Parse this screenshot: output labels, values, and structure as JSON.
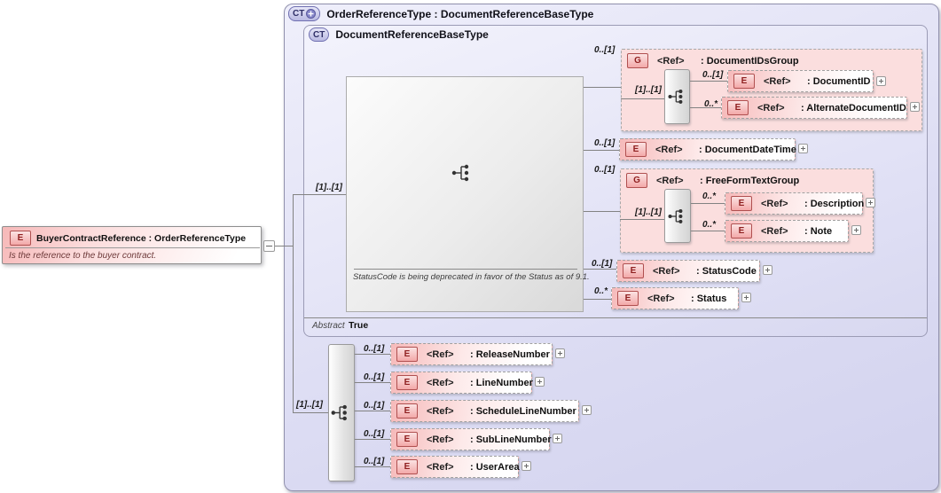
{
  "palette": {
    "container_fill": "#dcdcf3",
    "element_pink": "#f6baba",
    "badge_text_red": "#8f1f1f",
    "ct_badge_fill": "#c3c3e8",
    "connector_gray": "#828282"
  },
  "left_element": {
    "badge": "E",
    "title": "BuyerContractReference : OrderReferenceType",
    "annotation": "Is the reference to the buyer contract."
  },
  "outer_type": {
    "badge": "CT",
    "title": "OrderReferenceType : DocumentReferenceBaseType"
  },
  "base_type": {
    "badge": "CT",
    "title": "DocumentReferenceBaseType",
    "abstract_label": "Abstract",
    "abstract_value": "True",
    "model_note": "StatusCode is being deprecated in favor of the Status as of 9.1.",
    "model_card": "[1]..[1]"
  },
  "extension_card": "[1]..[1]",
  "top": [
    {
      "kind": "group",
      "card": "0..[1]",
      "badge": "G",
      "ref": "<Ref>",
      "name": ": DocumentIDsGroup",
      "inner_card": "[1]..[1]",
      "children": [
        {
          "card": "0..[1]",
          "badge": "E",
          "ref": "<Ref>",
          "name": ": DocumentID"
        },
        {
          "card": "0..*",
          "badge": "E",
          "ref": "<Ref>",
          "name": ": AlternateDocumentID"
        }
      ]
    },
    {
      "kind": "element",
      "card": "0..[1]",
      "badge": "E",
      "ref": "<Ref>",
      "name": ": DocumentDateTime"
    },
    {
      "kind": "group",
      "card": "0..[1]",
      "badge": "G",
      "ref": "<Ref>",
      "name": ": FreeFormTextGroup",
      "inner_card": "[1]..[1]",
      "children": [
        {
          "card": "0..*",
          "badge": "E",
          "ref": "<Ref>",
          "name": ": Description"
        },
        {
          "card": "0..*",
          "badge": "E",
          "ref": "<Ref>",
          "name": ": Note"
        }
      ]
    },
    {
      "kind": "element",
      "card": "0..[1]",
      "badge": "E",
      "ref": "<Ref>",
      "name": ": StatusCode"
    },
    {
      "kind": "element",
      "card": "0..*",
      "badge": "E",
      "ref": "<Ref>",
      "name": ": Status"
    }
  ],
  "bottom": [
    {
      "card": "0..[1]",
      "badge": "E",
      "ref": "<Ref>",
      "name": ": ReleaseNumber"
    },
    {
      "card": "0..[1]",
      "badge": "E",
      "ref": "<Ref>",
      "name": ": LineNumber"
    },
    {
      "card": "0..[1]",
      "badge": "E",
      "ref": "<Ref>",
      "name": ": ScheduleLineNumber"
    },
    {
      "card": "0..[1]",
      "badge": "E",
      "ref": "<Ref>",
      "name": ": SubLineNumber"
    },
    {
      "card": "0..[1]",
      "badge": "E",
      "ref": "<Ref>",
      "name": ": UserArea"
    }
  ]
}
